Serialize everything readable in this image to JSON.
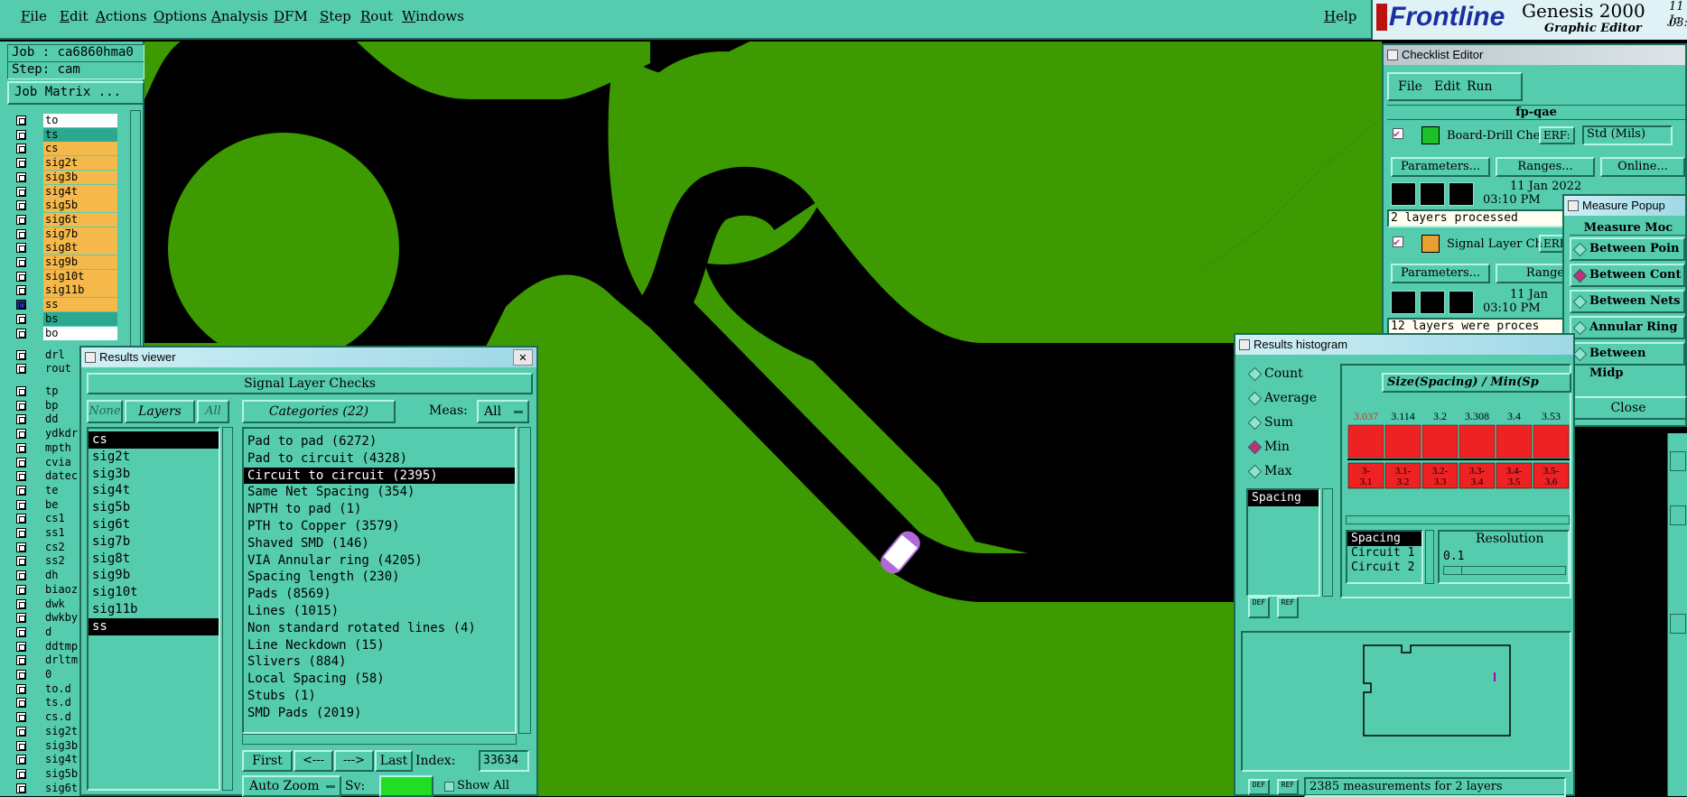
{
  "menu": {
    "items": [
      "File",
      "Edit",
      "Actions",
      "Options",
      "Analysis",
      "DFM",
      "Step",
      "Rout",
      "Windows"
    ],
    "help": "Help"
  },
  "brand": {
    "logo": "Frontline",
    "product": "Genesis 2000",
    "subtitle": "Graphic Editor",
    "date_frag": "11 Ja",
    "time_frag": "03:0"
  },
  "job": {
    "job_label": "Job : ca6860hma0",
    "step_label": "Step: cam",
    "matrix_button": "Job Matrix ..."
  },
  "layers": {
    "group1": [
      {
        "n": "to",
        "c": "#ffffff"
      },
      {
        "n": "ts",
        "c": "#2aa890"
      },
      {
        "n": "cs",
        "c": "#f5b84a"
      },
      {
        "n": "sig2t",
        "c": "#f5b84a"
      },
      {
        "n": "sig3b",
        "c": "#f5b84a"
      },
      {
        "n": "sig4t",
        "c": "#f5b84a"
      },
      {
        "n": "sig5b",
        "c": "#f5b84a"
      },
      {
        "n": "sig6t",
        "c": "#f5b84a"
      },
      {
        "n": "sig7b",
        "c": "#f5b84a"
      },
      {
        "n": "sig8t",
        "c": "#f5b84a"
      },
      {
        "n": "sig9b",
        "c": "#f5b84a"
      },
      {
        "n": "sig10t",
        "c": "#f5b84a"
      },
      {
        "n": "sig11b",
        "c": "#f5b84a"
      },
      {
        "n": "ss",
        "c": "#f5b84a"
      },
      {
        "n": "bs",
        "c": "#2aa890"
      },
      {
        "n": "bo",
        "c": "#ffffff"
      }
    ],
    "group2": [
      "drl",
      "rout"
    ],
    "group3": [
      "tp",
      "bp",
      "dd",
      "ydkdr",
      "mpth",
      "cvia",
      "datec",
      "te",
      "be",
      "cs1",
      "ss1",
      "cs2",
      "ss2",
      "dh",
      "biaoz",
      "dwk",
      "dwkby",
      "d",
      "ddtmp",
      "drltm",
      "0",
      "to.d",
      "ts.d",
      "cs.d",
      "sig2t",
      "sig3b",
      "sig4t",
      "sig5b",
      "sig6t"
    ]
  },
  "results_viewer": {
    "title": "Results viewer",
    "header": "Signal Layer Checks",
    "none_btn": "None",
    "layers_btn": "Layers",
    "all_btn": "All",
    "categories_btn": "Categories (22)",
    "meas_label": "Meas:",
    "meas_value": "All",
    "layers": [
      "cs",
      "sig2t",
      "sig3b",
      "sig4t",
      "sig5b",
      "sig6t",
      "sig7b",
      "sig8t",
      "sig9b",
      "sig10t",
      "sig11b",
      "ss"
    ],
    "categories": [
      "Pad to pad (6272)",
      "Pad to circuit (4328)",
      "Circuit to circuit (2395)",
      "Same Net Spacing (354)",
      "NPTH to pad (1)",
      "PTH to Copper (3579)",
      "Shaved SMD (146)",
      "VIA Annular ring (4205)",
      "Spacing length (230)",
      "Pads (8569)",
      "Lines (1015)",
      "Non standard rotated lines (4)",
      "Line Neckdown (15)",
      "Slivers (884)",
      "Local Spacing (58)",
      "Stubs (1)",
      "SMD Pads (2019)"
    ],
    "first": "First",
    "prev": "<---",
    "next": "--->",
    "last": "Last",
    "index_label": "Index:",
    "index_value": "33634",
    "autozoom": "Auto Zoom",
    "sv_label": "Sv:",
    "show_all": "Show All"
  },
  "checklist": {
    "title": "Checklist Editor",
    "menus": [
      "File",
      "Edit",
      "Run"
    ],
    "name": "fp-qae",
    "check1": {
      "name": "Board-Drill Che",
      "erf": "ERF:",
      "erf_value": "Std (Mils)",
      "params": "Parameters...",
      "ranges": "Ranges...",
      "online": "Online...",
      "date": "11 Jan 2022",
      "time": "03:10 PM",
      "status": "2 layers processed"
    },
    "check2": {
      "name": "Signal Layer Ch",
      "erf": "ERI",
      "params": "Parameters...",
      "ranges": "Range",
      "date": "11 Jan",
      "time": "03:10 PM",
      "status": "12 layers were proces"
    }
  },
  "measure": {
    "title": "Measure Popup",
    "header": "Measure Moc",
    "options": [
      "Between Poin",
      "Between Cont",
      "Between Nets",
      "Annular Ring",
      "Between Midp"
    ],
    "selected": 1,
    "close": "Close"
  },
  "histogram": {
    "title": "Results histogram",
    "modes": [
      "Count",
      "Average",
      "Sum",
      "Min",
      "Max"
    ],
    "selected_mode": 3,
    "list_item": "Spacing",
    "chart_title": "Size(Spacing) / Min(Sp",
    "resolution_label": "Resolution",
    "resolution_value": "0.1",
    "rows": [
      "Spacing",
      "Circuit 1",
      "Circuit 2"
    ],
    "def": "DEF",
    "ref": "REF",
    "status": "2385 measurements for 2 layers"
  },
  "chart_data": {
    "type": "bar",
    "categories": [
      "3-\n3.1",
      "3.1-\n3.2",
      "3.2-\n3.3",
      "3.3-\n3.4",
      "3.4-\n3.5",
      "3.5-\n3.6"
    ],
    "category_labels": [
      [
        "3-",
        "3.1"
      ],
      [
        "3.1-",
        "3.2"
      ],
      [
        "3.2-",
        "3.3"
      ],
      [
        "3.3-",
        "3.4"
      ],
      [
        "3.4-",
        "3.5"
      ],
      [
        "3.5-",
        "3.6"
      ]
    ],
    "values": [
      3.037,
      3.114,
      3.2,
      3.308,
      3.4,
      3.53
    ],
    "value_labels": [
      "3.037",
      "3.114",
      "3.2",
      "3.308",
      "3.4",
      "3.53"
    ],
    "title": "Size(Spacing) / Min(Sp",
    "bar_color": "#ee2222",
    "highlight_first_label": "#ee2222"
  }
}
